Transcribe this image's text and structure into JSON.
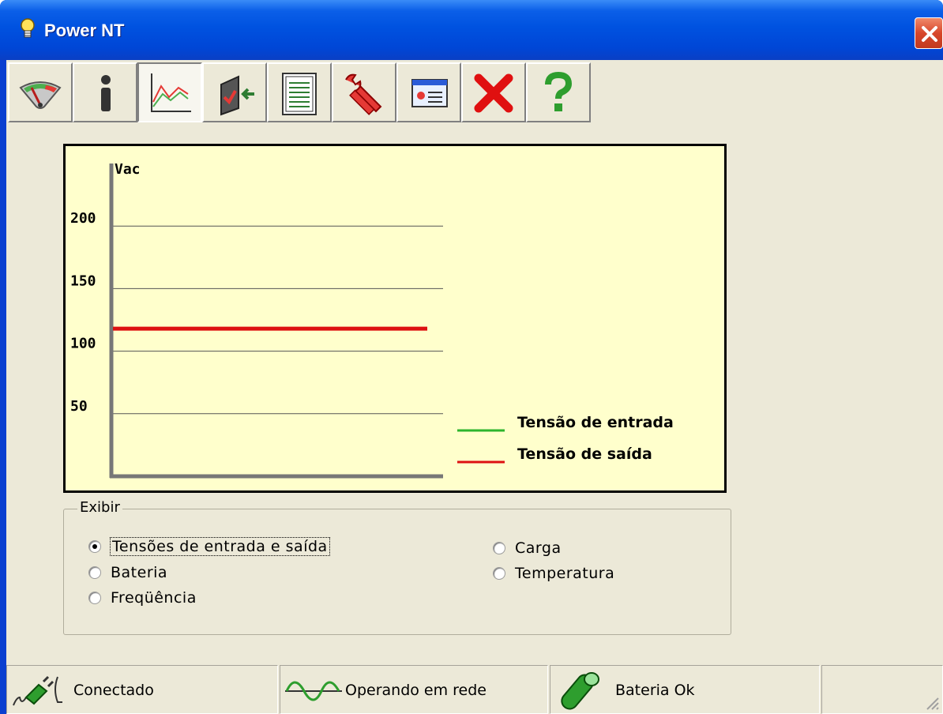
{
  "window": {
    "title": "Power NT"
  },
  "toolbar": {
    "buttons": [
      {
        "name": "gauge-icon",
        "active": false
      },
      {
        "name": "info-icon",
        "active": false
      },
      {
        "name": "chart-icon",
        "active": true
      },
      {
        "name": "import-icon",
        "active": false
      },
      {
        "name": "report-icon",
        "active": false
      },
      {
        "name": "wrench-icon",
        "active": false
      },
      {
        "name": "panel-icon",
        "active": false
      },
      {
        "name": "close-x-icon",
        "active": false
      },
      {
        "name": "help-icon",
        "active": false
      }
    ]
  },
  "chart_data": {
    "type": "line",
    "ylabel": "Vac",
    "yticks": [
      "200",
      "150",
      "100",
      "50"
    ],
    "ylim": [
      0,
      250
    ],
    "series": [
      {
        "name": "Tensão de entrada",
        "color": "#2db52d",
        "values": [
          118,
          118,
          118,
          118,
          118,
          118,
          118,
          118
        ]
      },
      {
        "name": "Tensão de saída",
        "color": "#dd1111",
        "values": [
          118,
          118,
          118,
          118,
          118,
          118,
          118,
          118
        ]
      }
    ],
    "grid": true,
    "legend": "bottom-right"
  },
  "display_group": {
    "legend": "Exibir",
    "options": [
      {
        "label": "Tensões de entrada e saída",
        "checked": true
      },
      {
        "label": "Bateria",
        "checked": false
      },
      {
        "label": "Freqüência",
        "checked": false
      },
      {
        "label": "Carga",
        "checked": false
      },
      {
        "label": "Temperatura",
        "checked": false
      }
    ]
  },
  "status": {
    "connection": "Conectado",
    "mode": "Operando em rede",
    "battery": "Bateria Ok"
  }
}
